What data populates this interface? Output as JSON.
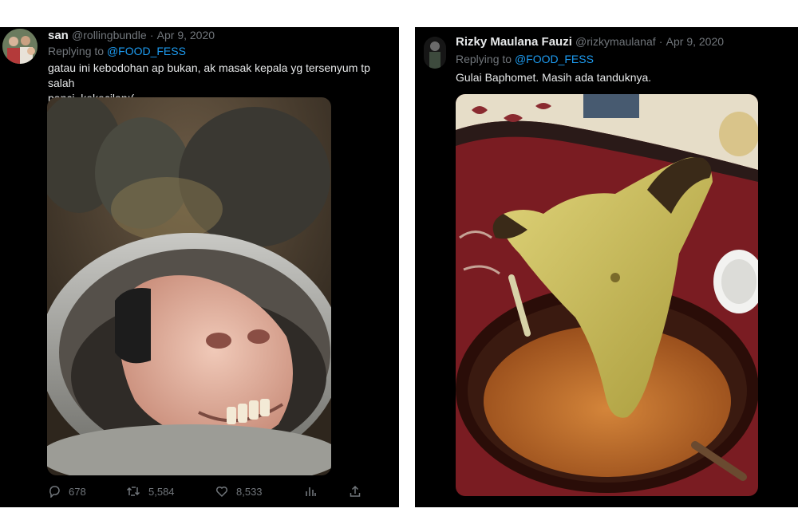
{
  "tweet_left": {
    "display_name": "san",
    "handle": "@rollingbundle",
    "date": "Apr 9, 2020",
    "replying_prefix": "Replying to",
    "replying_to": "@FOOD_FESS",
    "text_line1": "gatau ini kebodohan ap bukan, ak masak kepala yg tersenyum tp salah",
    "text_line2": "panci, kekecilan:(",
    "stats": {
      "replies": "678",
      "retweets": "5,584",
      "likes": "8,533"
    }
  },
  "tweet_right": {
    "display_name": "Rizky Maulana Fauzi",
    "handle": "@rizkymaulanaf",
    "date": "Apr 9, 2020",
    "replying_prefix": "Replying to",
    "replying_to": "@FOOD_FESS",
    "text": "Gulai Baphomet. Masih ada tanduknya."
  },
  "icons": {
    "reply": "reply-icon",
    "retweet": "retweet-icon",
    "like": "heart-icon",
    "analytics": "analytics-icon",
    "share": "share-icon"
  },
  "colors": {
    "background": "#000000",
    "text": "#e7e9ea",
    "muted": "#71767b",
    "link": "#1d9bf0"
  }
}
